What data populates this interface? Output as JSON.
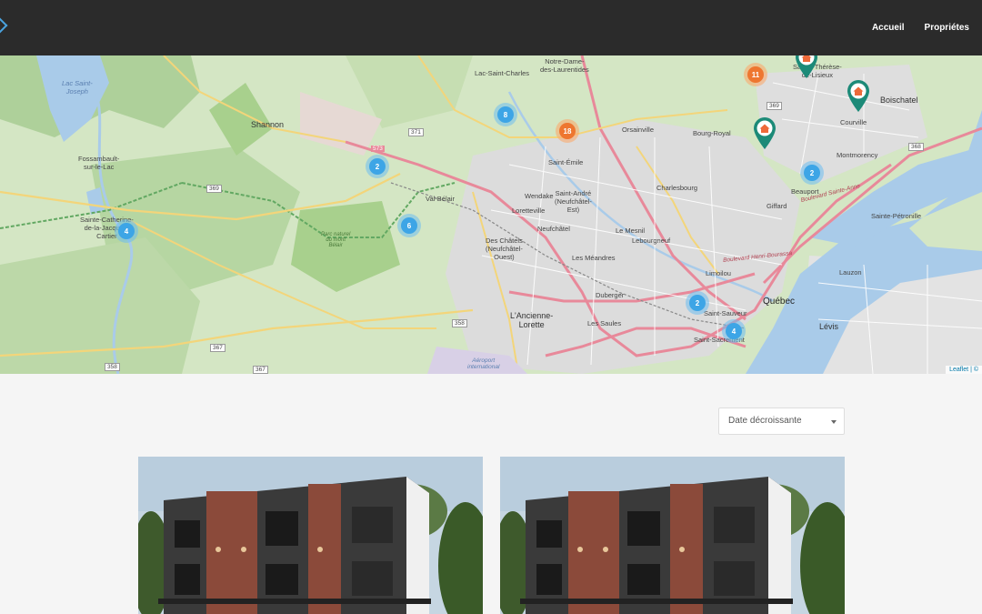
{
  "nav": {
    "items": [
      {
        "label": "Accueil"
      },
      {
        "label": "Propriétes"
      }
    ]
  },
  "map": {
    "labels": {
      "lac_saint_joseph": "Lac Saint-\nJoseph",
      "shannon": "Shannon",
      "fossambault": "Fossambault-\nsur-le-Lac",
      "sainte_catherine": "Sainte-Catherine-\nde-la-Jacques-\nCartier",
      "lac_saint_charles": "Lac-Saint-Charles",
      "notre_dame": "Notre-Dame-\ndes-Laurentides",
      "orsainville": "Orsainville",
      "bourg_royal": "Bourg-Royal",
      "sainte_therese": "Sainte-Thérèse-\nde-Lisieux",
      "boischatel": "Boischatel",
      "courville": "Courville",
      "montmorency": "Montmorency",
      "saint_emile": "Saint-Émile",
      "val_belair": "Val-Bélair",
      "wendake": "Wendake",
      "saint_andre": "Saint-André\n(Neufchâtel-\nEst)",
      "charlesbourg": "Charlesbourg",
      "beauport": "Beauport",
      "giffard": "Giffard",
      "loretteville": "Loretteville",
      "neufchatel": "Neufchâtel",
      "le_mesnil": "Le Mesnil",
      "lebourgneuf": "Lebourgneuf",
      "des_chatels": "Des Châtels\n(Neufchâtel-\nOuest)",
      "les_meandres": "Les Méandres",
      "limoilou": "Limoilou",
      "duberger": "Duberger",
      "ancienne_lorette": "L'Ancienne-\nLorette",
      "les_saules": "Les Saules",
      "saint_sauveur": "Saint-Sauveur",
      "quebec": "Québec",
      "levis": "Lévis",
      "lauzon": "Lauzon",
      "sainte_petronille": "Sainte-Pétronille",
      "saint_sacrement": "Saint-Sacrement",
      "airport": "Aéroport\ninternational",
      "parc": "Parc naturel\ndu mont\nBélair",
      "blvd_henri": "Boulevard Henri-Bourassa",
      "blvd_sainte_anne": "Boulevard Sainte-Anne",
      "road_371": "371",
      "road_573": "573",
      "road_369a": "369",
      "road_369b": "369",
      "road_358a": "358",
      "road_358b": "358",
      "road_367a": "367",
      "road_367b": "367",
      "road_368": "368"
    },
    "clusters": [
      {
        "name": "cluster-11",
        "count": "11",
        "color": "orange"
      },
      {
        "name": "cluster-18",
        "count": "18",
        "color": "orange"
      },
      {
        "name": "cluster-8",
        "count": "8",
        "color": "blue"
      },
      {
        "name": "cluster-2-valbelair",
        "count": "2",
        "color": "blue"
      },
      {
        "name": "cluster-6",
        "count": "6",
        "color": "blue"
      },
      {
        "name": "cluster-4-catherine",
        "count": "4",
        "color": "blue"
      },
      {
        "name": "cluster-2-beauport",
        "count": "2",
        "color": "blue"
      },
      {
        "name": "cluster-2-sauveur",
        "count": "2",
        "color": "blue"
      },
      {
        "name": "cluster-4-sacrement",
        "count": "4",
        "color": "blue"
      }
    ],
    "attribution": "Leaflet | ©"
  },
  "sort": {
    "selected": "Date décroissante"
  },
  "colors": {
    "topbar": "#2b2b2b",
    "cluster_blue": "#3da5e6",
    "cluster_orange": "#ee7630",
    "pin_teal": "#1c8a78",
    "brick": "#8b4a3a"
  }
}
